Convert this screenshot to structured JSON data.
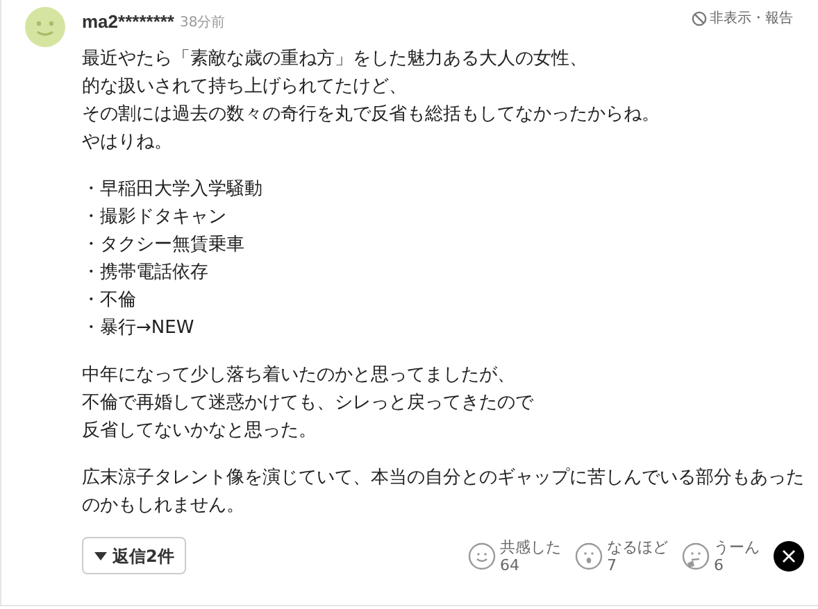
{
  "comment": {
    "user": "ma2********",
    "time": "38分前",
    "report": "非表示・報告",
    "paragraphs": [
      [
        "最近やたら「素敵な歳の重ね方」をした魅力ある大人の女性、",
        "的な扱いされて持ち上げられてたけど、",
        "その割には過去の数々の奇行を丸で反省も総括もしてなかったからね。",
        "やはりね。"
      ],
      [
        "・早稲田大学入学騒動",
        "・撮影ドタキャン",
        "・タクシー無賃乗車",
        "・携帯電話依存",
        "・不倫",
        "・暴行→NEW"
      ],
      [
        "中年になって少し落ち着いたのかと思ってましたが、",
        "不倫で再婚して迷惑かけても、シレっと戻ってきたので",
        "反省してないかなと思った。"
      ],
      [
        "広末涼子タレント像を演じていて、本当の自分とのギャップに苦しんでいる部分もあったのかもしれません。"
      ]
    ],
    "replies": {
      "label": "返信2件",
      "expanded": false
    },
    "reactions": [
      {
        "kind": "smile",
        "label": "共感した",
        "count": "64"
      },
      {
        "kind": "surprise",
        "label": "なるほど",
        "count": "7"
      },
      {
        "kind": "hmm",
        "label": "うーん",
        "count": "6"
      }
    ]
  }
}
